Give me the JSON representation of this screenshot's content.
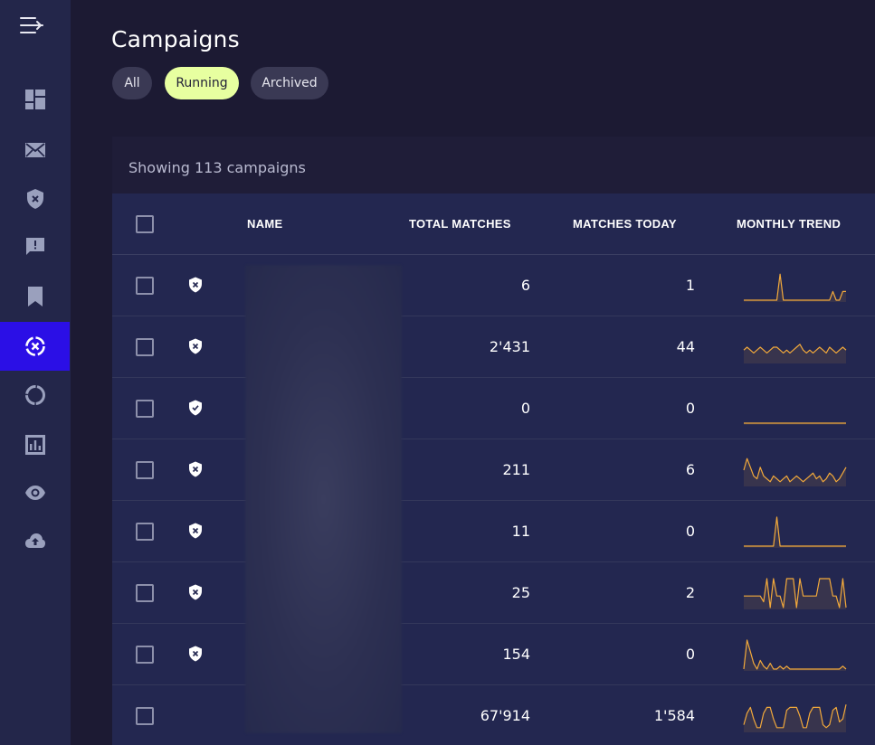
{
  "sidebar": {
    "items": [
      {
        "name": "dashboard-icon",
        "active": false
      },
      {
        "name": "mail-icon",
        "active": false
      },
      {
        "name": "shield-x-icon",
        "active": false
      },
      {
        "name": "feedback-icon",
        "active": false
      },
      {
        "name": "bookmark-icon",
        "active": false
      },
      {
        "name": "campaigns-icon",
        "active": true
      },
      {
        "name": "circle-progress-icon",
        "active": false
      },
      {
        "name": "analytics-icon",
        "active": false
      },
      {
        "name": "eye-icon",
        "active": false
      },
      {
        "name": "cloud-upload-icon",
        "active": false
      }
    ]
  },
  "page": {
    "title": "Campaigns"
  },
  "filters": [
    {
      "label": "All",
      "active": false
    },
    {
      "label": "Running",
      "active": true
    },
    {
      "label": "Archived",
      "active": false
    }
  ],
  "table": {
    "showing": "Showing 113 campaigns",
    "headers": {
      "name": "NAME",
      "total": "TOTAL MATCHES",
      "today": "MATCHES TODAY",
      "trend": "MONTHLY TREND"
    },
    "rows": [
      {
        "icon": "shield-x-icon",
        "total": "6",
        "today": "1",
        "trend": [
          0,
          0,
          0,
          0,
          0,
          0,
          0,
          0,
          0,
          0,
          0,
          9,
          0,
          0,
          0,
          0,
          0,
          0,
          0,
          0,
          0,
          0,
          0,
          0,
          0,
          0,
          0,
          3,
          0,
          0,
          3,
          3
        ]
      },
      {
        "icon": "shield-x-icon",
        "total": "2'431",
        "today": "44",
        "trend": [
          4,
          5,
          4,
          3,
          4,
          5,
          4,
          3,
          4,
          5,
          5,
          4,
          3,
          4,
          3,
          4,
          5,
          6,
          4,
          3,
          4,
          3,
          4,
          5,
          4,
          3,
          5,
          4,
          3,
          4,
          5,
          4
        ]
      },
      {
        "icon": "shield-check-icon",
        "total": "0",
        "today": "0",
        "trend": [
          0,
          0,
          0,
          0,
          0,
          0,
          0,
          0,
          0,
          0,
          0,
          0,
          0,
          0,
          0,
          0,
          0,
          0,
          0,
          0,
          0,
          0,
          0,
          0,
          0,
          0,
          0,
          0,
          0,
          0,
          0,
          0
        ]
      },
      {
        "icon": "shield-x-icon",
        "total": "211",
        "today": "6",
        "trend": [
          5,
          9,
          6,
          3,
          2,
          6,
          3,
          2,
          1,
          3,
          2,
          1,
          2,
          3,
          1,
          2,
          3,
          2,
          1,
          2,
          3,
          4,
          2,
          3,
          1,
          2,
          4,
          3,
          1,
          2,
          4,
          6
        ]
      },
      {
        "icon": "shield-x-icon",
        "total": "11",
        "today": "0",
        "trend": [
          0,
          0,
          0,
          0,
          0,
          0,
          0,
          0,
          0,
          0,
          10,
          0,
          0,
          0,
          0,
          0,
          0,
          0,
          0,
          0,
          0,
          0,
          0,
          0,
          0,
          0,
          0,
          0,
          0,
          0,
          0,
          0
        ]
      },
      {
        "icon": "shield-x-icon",
        "total": "25",
        "today": "2",
        "trend": [
          4,
          4,
          4,
          4,
          4,
          4,
          2,
          10,
          0,
          10,
          4,
          4,
          0,
          10,
          10,
          10,
          0,
          10,
          4,
          4,
          4,
          4,
          4,
          10,
          10,
          10,
          10,
          4,
          4,
          0,
          10,
          0
        ]
      },
      {
        "icon": "shield-x-icon",
        "total": "154",
        "today": "0",
        "trend": [
          0,
          10,
          6,
          2,
          0,
          3,
          1,
          0,
          2,
          0,
          0,
          1,
          0,
          1,
          0,
          0,
          0,
          0,
          0,
          0,
          0,
          0,
          0,
          0,
          0,
          0,
          0,
          0,
          0,
          0,
          1,
          0
        ]
      },
      {
        "icon": "",
        "total": "67'914",
        "today": "1'584",
        "trend": [
          2,
          6,
          8,
          4,
          1,
          1,
          6,
          8,
          8,
          4,
          1,
          1,
          1,
          7,
          8,
          8,
          8,
          5,
          1,
          1,
          6,
          8,
          8,
          8,
          2,
          1,
          2,
          7,
          8,
          3,
          4,
          9
        ]
      }
    ]
  },
  "colors": {
    "accent": "#2b0fe6",
    "filter_active": "#e7ffa0",
    "spark": "#f2a93b"
  }
}
